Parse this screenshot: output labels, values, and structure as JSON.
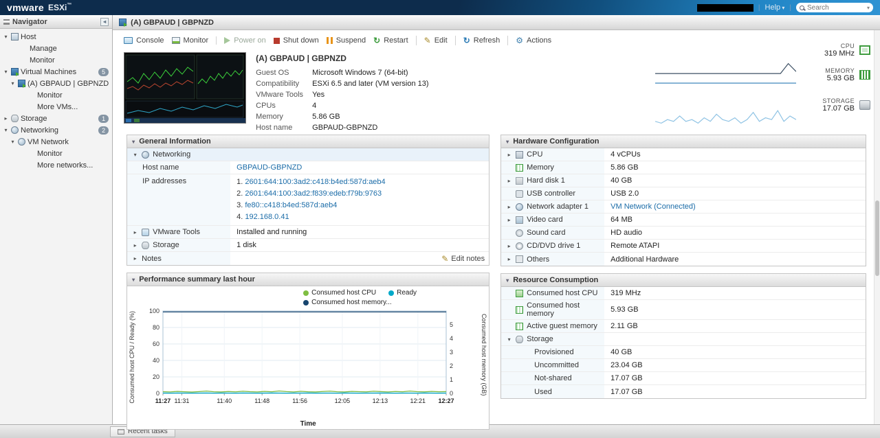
{
  "header": {
    "brand": "vmware",
    "product": "ESXi",
    "trademark": "™",
    "help_label": "Help",
    "search_placeholder": "Search"
  },
  "navigator": {
    "title": "Navigator",
    "items": [
      {
        "label": "Host",
        "indent": "lvl0",
        "twisty": "▾",
        "icon": "ico-host",
        "cls": ""
      },
      {
        "label": "Manage",
        "indent": "lvl2",
        "twisty": "",
        "icon": "",
        "cls": ""
      },
      {
        "label": "Monitor",
        "indent": "lvl2",
        "twisty": "",
        "icon": "",
        "cls": ""
      },
      {
        "label": "Virtual Machines",
        "indent": "lvl0",
        "twisty": "▾",
        "icon": "ico-vm",
        "badge": "5",
        "cls": "ancestor"
      },
      {
        "label": "(A) GBPAUD | GBPNZD",
        "indent": "lvl1",
        "twisty": "▾",
        "icon": "ico-vm",
        "cls": "selected"
      },
      {
        "label": "Monitor",
        "indent": "lvl3",
        "twisty": "",
        "icon": "",
        "cls": ""
      },
      {
        "label": "More VMs...",
        "indent": "lvl3",
        "twisty": "",
        "icon": "",
        "cls": ""
      },
      {
        "label": "Storage",
        "indent": "lvl0",
        "twisty": "▸",
        "icon": "ico-storage-sm",
        "badge": "1",
        "cls": ""
      },
      {
        "label": "Networking",
        "indent": "lvl0",
        "twisty": "▾",
        "icon": "ico-net",
        "badge": "2",
        "cls": ""
      },
      {
        "label": "VM Network",
        "indent": "lvl1",
        "twisty": "▾",
        "icon": "ico-net",
        "cls": ""
      },
      {
        "label": "Monitor",
        "indent": "lvl3",
        "twisty": "",
        "icon": "",
        "cls": ""
      },
      {
        "label": "More networks...",
        "indent": "lvl3",
        "twisty": "",
        "icon": "",
        "cls": ""
      }
    ]
  },
  "title_bar": {
    "title": "(A) GBPAUD | GBPNZD"
  },
  "toolbar": {
    "items": [
      {
        "label": "Console",
        "icon": "i-console",
        "cls": ""
      },
      {
        "label": "Monitor",
        "icon": "i-monitor",
        "cls": ""
      },
      {
        "label": "Power on",
        "icon": "i-play",
        "cls": "disabled sep"
      },
      {
        "label": "Shut down",
        "icon": "i-stop",
        "cls": ""
      },
      {
        "label": "Suspend",
        "icon": "i-pause",
        "cls": ""
      },
      {
        "label": "Restart",
        "icon": "i-restart",
        "cls": ""
      },
      {
        "label": "Edit",
        "icon": "i-edit",
        "cls": "sep"
      },
      {
        "label": "Refresh",
        "icon": "i-refresh",
        "cls": "sep"
      },
      {
        "label": "Actions",
        "icon": "i-actions",
        "cls": "sep"
      }
    ]
  },
  "vm_summary": {
    "title": "(A) GBPAUD | GBPNZD",
    "rows": [
      {
        "label": "Guest OS",
        "value": "Microsoft Windows 7 (64-bit)"
      },
      {
        "label": "Compatibility",
        "value": "ESXi 6.5 and later (VM version 13)"
      },
      {
        "label": "VMware Tools",
        "value": "Yes"
      },
      {
        "label": "CPUs",
        "value": "4"
      },
      {
        "label": "Memory",
        "value": "5.86 GB"
      },
      {
        "label": "Host name",
        "value": "GBPAUD-GBPNZD"
      }
    ]
  },
  "stats": [
    {
      "label": "CPU",
      "value": "319 MHz",
      "icon": "ico-cpu-stat"
    },
    {
      "label": "MEMORY",
      "value": "5.93 GB",
      "icon": "ico-mem-stat"
    },
    {
      "label": "STORAGE",
      "value": "17.07 GB",
      "icon": "ico-sto-stat"
    }
  ],
  "general": {
    "title": "General Information",
    "networking_label": "Networking",
    "host_name_label": "Host name",
    "host_name_value": "GBPAUD-GBPNZD",
    "ip_label": "IP addresses",
    "ips": [
      {
        "num": "1.",
        "addr": "2601:644:100:3ad2:c418:b4ed:587d:aeb4"
      },
      {
        "num": "2.",
        "addr": "2601:644:100:3ad2:f839:edeb:f79b:9763"
      },
      {
        "num": "3.",
        "addr": "fe80::c418:b4ed:587d:aeb4"
      },
      {
        "num": "4.",
        "addr": "192.168.0.41"
      }
    ],
    "tools_label": "VMware Tools",
    "tools_value": "Installed and running",
    "storage_label": "Storage",
    "storage_value": "1 disk",
    "notes_label": "Notes",
    "edit_notes_label": "Edit notes"
  },
  "hardware": {
    "title": "Hardware Configuration",
    "rows": [
      {
        "label": "CPU",
        "value": "4 vCPUs",
        "icon": "ico-chip",
        "twisty": "▸",
        "vcls": ""
      },
      {
        "label": "Memory",
        "value": "5.86 GB",
        "icon": "ico-mem",
        "twisty": "",
        "vcls": ""
      },
      {
        "label": "Hard disk 1",
        "value": "40 GB",
        "icon": "ico-disk",
        "twisty": "▸",
        "vcls": ""
      },
      {
        "label": "USB controller",
        "value": "USB 2.0",
        "icon": "ico-usb",
        "twisty": "",
        "vcls": ""
      },
      {
        "label": "Network adapter 1",
        "value": "VM Network (Connected)",
        "icon": "ico-net",
        "twisty": "▸",
        "vcls": "link"
      },
      {
        "label": "Video card",
        "value": "64 MB",
        "icon": "ico-video",
        "twisty": "▸",
        "vcls": ""
      },
      {
        "label": "Sound card",
        "value": "HD audio",
        "icon": "ico-sound",
        "twisty": "",
        "vcls": ""
      },
      {
        "label": "CD/DVD drive 1",
        "value": "Remote ATAPI",
        "icon": "ico-cd",
        "twisty": "▸",
        "vcls": ""
      },
      {
        "label": "Others",
        "value": "Additional Hardware",
        "icon": "ico-other",
        "twisty": "▸",
        "vcls": ""
      }
    ]
  },
  "performance": {
    "title": "Performance summary last hour",
    "xlabel": "Time",
    "ylabel_left": "Consumed host CPU / Ready (%)",
    "ylabel_right": "Consumed host memory (GB)",
    "legend": [
      {
        "label": "Consumed host CPU",
        "color": "#7fbe42"
      },
      {
        "label": "Ready",
        "color": "#00a9c9"
      },
      {
        "label": "Consumed host memory...",
        "color": "#17456e"
      }
    ]
  },
  "resource": {
    "title": "Resource Consumption",
    "rows": [
      {
        "label": "Consumed host CPU",
        "value": "319 MHz",
        "icon": "ico-perf",
        "twisty": "",
        "cls": ""
      },
      {
        "label": "Consumed host memory",
        "value": "5.93 GB",
        "icon": "ico-mem",
        "twisty": "",
        "cls": ""
      },
      {
        "label": "Active guest memory",
        "value": "2.11 GB",
        "icon": "ico-mem",
        "twisty": "",
        "cls": ""
      },
      {
        "label": "Storage",
        "value": "",
        "icon": "ico-storage-sm",
        "twisty": "▾",
        "cls": ""
      },
      {
        "label": "Provisioned",
        "value": "40 GB",
        "icon": "",
        "twisty": "",
        "cls": "sub"
      },
      {
        "label": "Uncommitted",
        "value": "23.04 GB",
        "icon": "",
        "twisty": "",
        "cls": "sub"
      },
      {
        "label": "Not-shared",
        "value": "17.07 GB",
        "icon": "",
        "twisty": "",
        "cls": "sub"
      },
      {
        "label": "Used",
        "value": "17.07 GB",
        "icon": "",
        "twisty": "",
        "cls": "sub"
      }
    ]
  },
  "recent_tasks": {
    "label": "Recent tasks"
  },
  "chart_data": {
    "type": "line",
    "title": "Performance summary last hour",
    "xlabel": "Time",
    "ylabel_left": "Consumed host CPU / Ready (%)",
    "ylabel_right": "Consumed host memory (GB)",
    "ylim_left": [
      0,
      100
    ],
    "ylim_right": [
      0,
      6
    ],
    "y_ticks_left": [
      0,
      20,
      40,
      60,
      80,
      100
    ],
    "y_ticks_right": [
      0,
      1,
      2,
      3,
      4,
      5
    ],
    "x_range_minutes": 60,
    "x_ticks": [
      {
        "label": "11:27",
        "t": 0,
        "bold": true
      },
      {
        "label": "11:31",
        "t": 4
      },
      {
        "label": "11:40",
        "t": 13
      },
      {
        "label": "11:48",
        "t": 21
      },
      {
        "label": "11:56",
        "t": 29
      },
      {
        "label": "12:05",
        "t": 38
      },
      {
        "label": "12:13",
        "t": 46
      },
      {
        "label": "12:21",
        "t": 54
      },
      {
        "label": "12:27",
        "t": 60,
        "bold": true
      }
    ],
    "series": [
      {
        "name": "Consumed host CPU",
        "axis": "left",
        "color": "#76b83f",
        "values": [
          2.1,
          1.8,
          2.4,
          2.0,
          1.6,
          2.2,
          2.8,
          2.0,
          1.7,
          2.3,
          1.9,
          2.6,
          2.1,
          1.8,
          2.4,
          2.0,
          2.9,
          2.2,
          1.8,
          2.5,
          2.0,
          1.7,
          2.3,
          2.7,
          2.0,
          1.8,
          2.4,
          2.1,
          1.9,
          2.6,
          2.2,
          1.8,
          2.3,
          2.0,
          2.8,
          2.1,
          1.9,
          2.4,
          2.0,
          2.2
        ]
      },
      {
        "name": "Ready",
        "axis": "left",
        "color": "#00a9c9",
        "values": [
          0.4,
          0.3,
          0.5,
          0.4,
          0.3,
          0.4,
          0.5,
          0.3,
          0.4,
          0.4,
          0.3,
          0.5,
          0.4,
          0.3,
          0.4,
          0.5,
          0.4,
          0.3,
          0.4,
          0.4,
          0.5,
          0.3,
          0.4,
          0.4,
          0.3,
          0.5,
          0.4,
          0.3,
          0.4,
          0.4,
          0.5,
          0.4,
          0.3,
          0.4,
          0.4,
          0.3,
          0.5,
          0.4,
          0.3,
          0.4
        ]
      },
      {
        "name": "Consumed host memory...",
        "axis": "right",
        "color": "#17456e",
        "values": [
          5.93,
          5.93
        ]
      }
    ],
    "sparklines": [
      {
        "name": "cpu",
        "color": "#3c4f63",
        "values": [
          1,
          1,
          1,
          1,
          1,
          1,
          1,
          1,
          1,
          1,
          1,
          1,
          1,
          1,
          1,
          1,
          1,
          6,
          2
        ]
      },
      {
        "name": "memory",
        "color": "#2a7ab5",
        "values": [
          5,
          5
        ]
      },
      {
        "name": "storage",
        "color": "#8fc3e4",
        "values": [
          2,
          1,
          3,
          2,
          5,
          2,
          3,
          1,
          4,
          2,
          6,
          3,
          2,
          4,
          1,
          3,
          7,
          2,
          4,
          3,
          8,
          2,
          5,
          3
        ]
      }
    ]
  }
}
